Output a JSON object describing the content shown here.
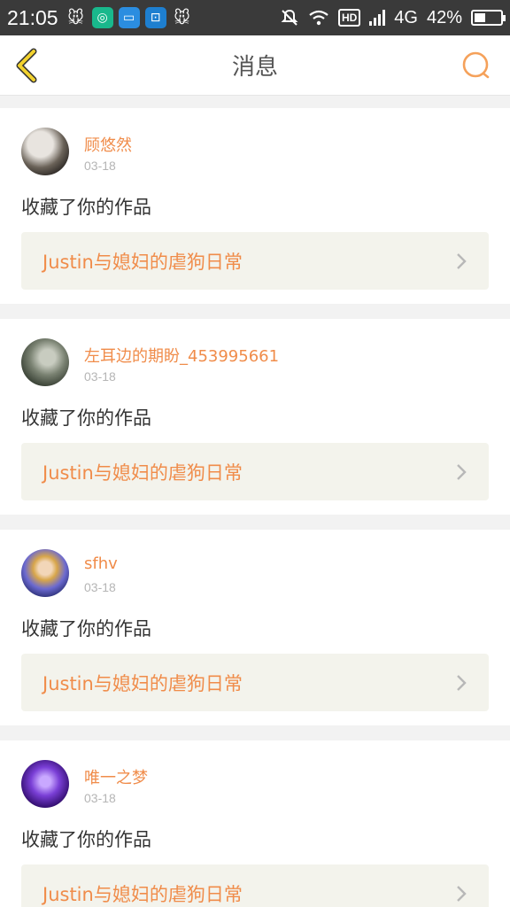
{
  "status_bar": {
    "time": "21:05",
    "network": "4G",
    "hd": "HD",
    "battery": "42%",
    "battery_level": 0.42
  },
  "header": {
    "title": "消息",
    "back_icon": "chevron-left-icon",
    "search_icon": "search-icon"
  },
  "colors": {
    "accent": "#f08c4a",
    "back_icon": "#e8c000"
  },
  "messages": [
    {
      "user": "顾悠然",
      "date": "03-18",
      "action": "收藏了你的作品",
      "work": "Justin与媳妇的虐狗日常"
    },
    {
      "user": "左耳边的期盼_453995661",
      "date": "03-18",
      "action": "收藏了你的作品",
      "work": "Justin与媳妇的虐狗日常"
    },
    {
      "user": "sfhv",
      "date": "03-18",
      "action": "收藏了你的作品",
      "work": "Justin与媳妇的虐狗日常"
    },
    {
      "user": "唯一之梦",
      "date": "03-18",
      "action": "收藏了你的作品",
      "work": "Justin与媳妇的虐狗日常"
    }
  ]
}
